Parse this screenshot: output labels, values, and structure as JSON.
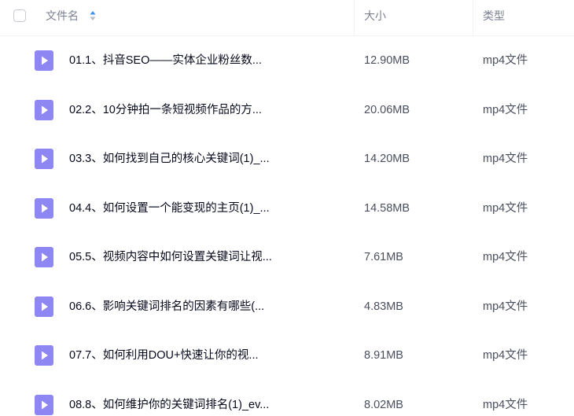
{
  "header": {
    "name_label": "文件名",
    "size_label": "大小",
    "type_label": "类型"
  },
  "colors": {
    "icon_purple": "#8e86f2",
    "sort_active": "#3a8ef6",
    "sort_inactive": "#b8bcc6"
  },
  "files": [
    {
      "name": "01.1、抖音SEO——实体企业粉丝数...",
      "size": "12.90MB",
      "type": "mp4文件",
      "icon": "video-file-icon"
    },
    {
      "name": "02.2、10分钟拍一条短视频作品的方...",
      "size": "20.06MB",
      "type": "mp4文件",
      "icon": "video-file-icon"
    },
    {
      "name": "03.3、如何找到自己的核心关键词(1)_...",
      "size": "14.20MB",
      "type": "mp4文件",
      "icon": "video-file-icon"
    },
    {
      "name": "04.4、如何设置一个能变现的主页(1)_...",
      "size": "14.58MB",
      "type": "mp4文件",
      "icon": "video-file-icon"
    },
    {
      "name": "05.5、视频内容中如何设置关键词让视...",
      "size": "7.61MB",
      "type": "mp4文件",
      "icon": "video-file-icon"
    },
    {
      "name": "06.6、影响关键词排名的因素有哪些(...",
      "size": "4.83MB",
      "type": "mp4文件",
      "icon": "video-file-icon"
    },
    {
      "name": "07.7、如何利用DOU+快速让你的视...",
      "size": "8.91MB",
      "type": "mp4文件",
      "icon": "video-file-icon"
    },
    {
      "name": "08.8、如何维护你的关键词排名(1)_ev...",
      "size": "8.02MB",
      "type": "mp4文件",
      "icon": "video-file-icon"
    }
  ]
}
